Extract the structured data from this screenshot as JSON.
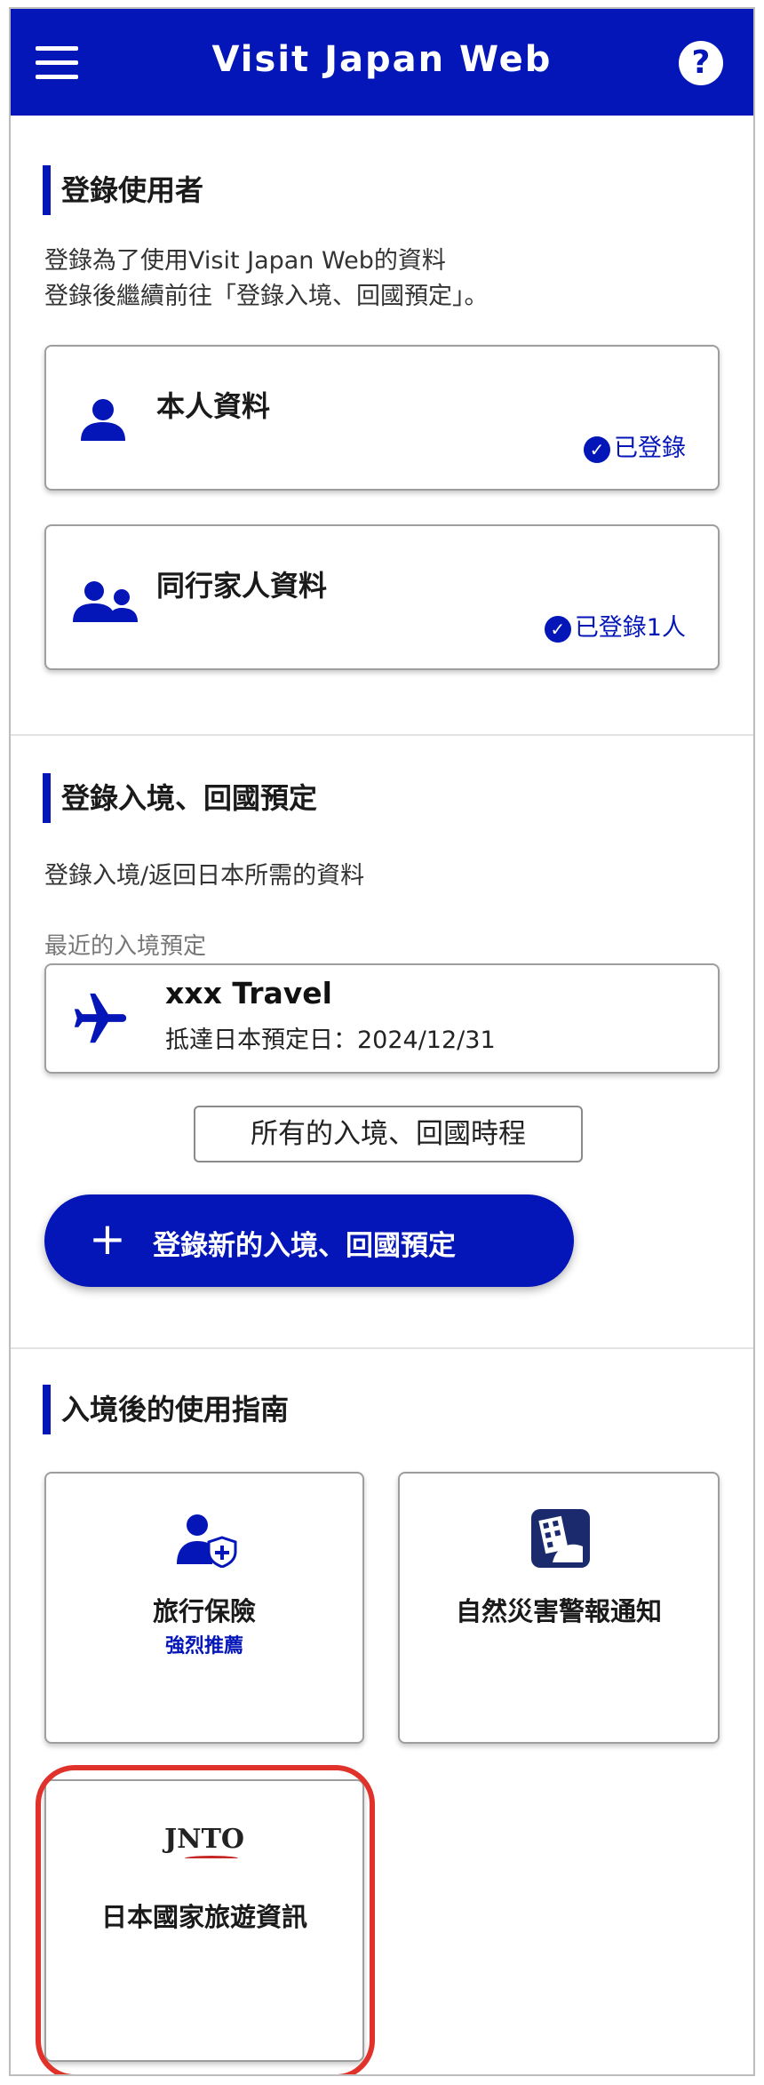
{
  "app": {
    "title": "Visit Japan Web",
    "help_glyph": "?"
  },
  "register_users": {
    "title": "登錄使用者",
    "desc_line1": "登錄為了使用Visit Japan Web的資料",
    "desc_line2": "登錄後繼續前往「登錄入境、回國預定」。",
    "self_card": {
      "label": "本人資料",
      "status": "已登錄",
      "icon": "person-icon"
    },
    "family_card": {
      "label": "同行家人資料",
      "status": "已登錄1人",
      "icon": "group-icon"
    }
  },
  "entry_plans": {
    "title": "登錄入境、回國預定",
    "desc": "登錄入境/返回日本所需的資料",
    "recent_label": "最近的入境預定",
    "trip": {
      "name": "xxx Travel",
      "date": "抵達日本預定日：2024/12/31",
      "icon": "airplane-icon"
    },
    "all_trips_button": "所有的入境、回國時程",
    "new_plan_button": "登錄新的入境、回國預定"
  },
  "guide": {
    "title": "入境後的使用指南",
    "tiles": [
      {
        "label": "旅行保險",
        "sub": "強烈推薦",
        "icon": "insurance-person-shield-icon"
      },
      {
        "label": "自然災害警報通知",
        "icon": "disaster-building-icon"
      },
      {
        "label": "日本國家旅遊資訊",
        "logo": "JNTO",
        "icon": "jnto-logo"
      }
    ]
  },
  "colors": {
    "brand": "#0416b8",
    "highlight_ring": "#e0312a"
  }
}
